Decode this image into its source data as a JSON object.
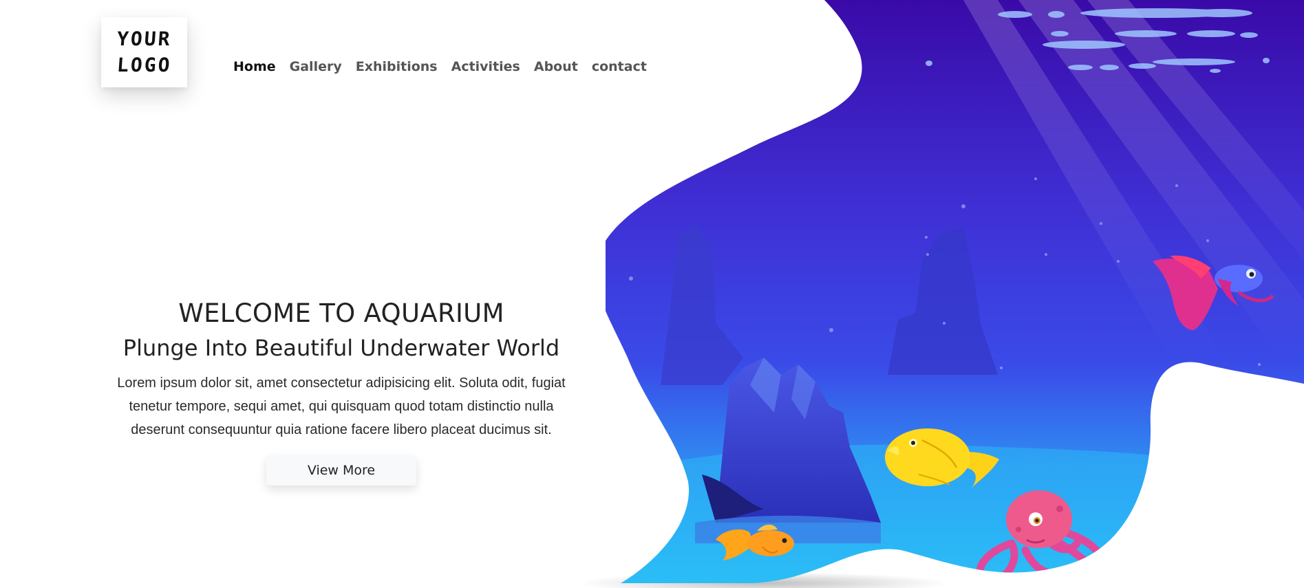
{
  "logo": {
    "line1": "YOUR",
    "line2": "LOGO"
  },
  "nav": {
    "items": [
      {
        "label": "Home"
      },
      {
        "label": "Gallery"
      },
      {
        "label": "Exhibitions"
      },
      {
        "label": "Activities"
      },
      {
        "label": "About"
      },
      {
        "label": "contact"
      }
    ]
  },
  "hero": {
    "title": "WELCOME TO AQUARIUM",
    "subtitle": "Plunge Into Beautiful Underwater World",
    "description": "Lorem ipsum dolor sit, amet consectetur adipisicing elit. Soluta odit, fugiat tenetur tempore, sequi amet, qui quisquam quod totam distinctio nulla deserunt consequuntur quia ratione facere libero placeat ducimus sit.",
    "button_label": "View More"
  },
  "illustration": {
    "icons": [
      "rock-icon",
      "goldfish-icon",
      "yellow-fish-icon",
      "betta-fish-icon",
      "octopus-icon"
    ]
  },
  "colors": {
    "water_top": "#3f0fb8",
    "water_mid": "#3a3ee0",
    "water_bottom": "#2aa8f5",
    "text": "#222222",
    "nav_active": "#111111",
    "nav_inactive": "#555555"
  }
}
